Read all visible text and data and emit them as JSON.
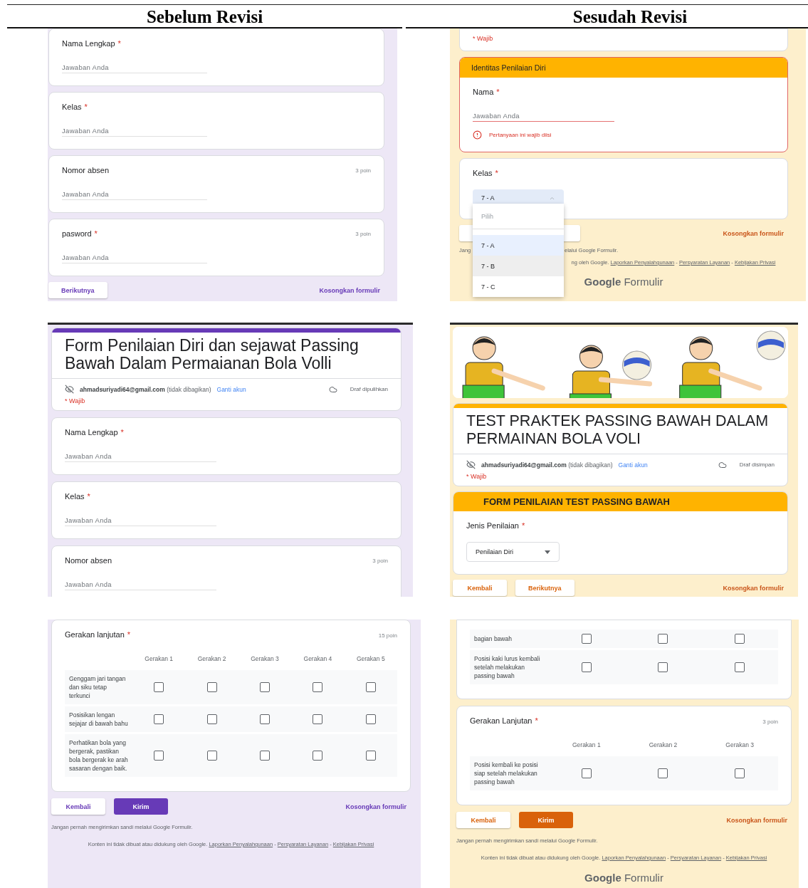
{
  "headings": [
    {
      "text": "Sebelum Revisi"
    },
    {
      "text": "Sesudah Revisi"
    }
  ],
  "panels": [
    {
      "kind": "purple",
      "blocks": [
        {
          "kind": "question",
          "label": "Nama Lengkap",
          "mark": "*",
          "placeholder": "Jawaban Anda"
        },
        {
          "kind": "question",
          "label": "Kelas",
          "mark": "*",
          "placeholder": "Jawaban Anda"
        },
        {
          "kind": "question",
          "label": "Nomor absen",
          "points": "3 poin",
          "placeholder": "Jawaban Anda"
        },
        {
          "kind": "question",
          "label": "pasword",
          "mark": "*",
          "points": "3 poin",
          "placeholder": "Jawaban Anda"
        },
        {
          "kind": "nav",
          "buttons": [
            {
              "label": "Berikutnya",
              "kind": "outlined"
            }
          ],
          "clear": "Kosongkan formulir"
        }
      ]
    },
    {
      "kind": "orange",
      "blocks": [
        {
          "kind": "note",
          "text": "* Wajib"
        },
        {
          "kind": "section",
          "title": "Identitas Penilaian Diri",
          "question": {
            "kind": "question",
            "label": "Nama",
            "mark": "*",
            "placeholder": "Jawaban Anda",
            "error": "Pertanyaan ini wajib diisi"
          }
        },
        {
          "kind": "select",
          "label": "Kelas",
          "mark": "*",
          "dropdown": {
            "value": "7 - A",
            "expanded": true,
            "options": [
              {
                "label": "Pilih",
                "kind": "placeholder",
                "selected": false,
                "highlighted": false
              },
              {
                "label": "7 - A",
                "kind": "option",
                "selected": true,
                "highlighted": false
              },
              {
                "label": "7 - B",
                "kind": "option",
                "selected": false,
                "highlighted": true
              },
              {
                "label": "7 - C",
                "kind": "option",
                "selected": false,
                "highlighted": false
              }
            ]
          }
        },
        {
          "kind": "nav",
          "buttons": [
            {
              "kind": "outlined"
            }
          ],
          "clear": "Kosongkan formulir"
        },
        {
          "kind": "covered_footer",
          "notice_parts": [
            "Jang",
            "elalui Google Formulir."
          ],
          "disclaimer": "ng oleh Google.",
          "links": [
            "Laporkan Penyalahgunaan",
            "Persyaratan Layanan",
            "Kebijakan Privasi"
          ],
          "separator": "-"
        },
        {
          "kind": "logo",
          "text": "**Google** Formulir"
        }
      ]
    },
    {
      "kind": "purple",
      "blocks": [
        {
          "kind": "header",
          "title": "Form Penilaian Diri dan sejawat Passing Bawah Dalam Permaianan Bola Volli",
          "account": "**ahmadsuriyadi64@gmail.com** (tidak dibagikan)",
          "switch": "Ganti akun",
          "draft": "Draf dipulihkan",
          "note": "* Wajib"
        },
        {
          "kind": "question",
          "label": "Nama Lengkap",
          "mark": "*",
          "placeholder": "Jawaban Anda"
        },
        {
          "kind": "question",
          "label": "Kelas",
          "mark": "*",
          "placeholder": "Jawaban Anda"
        },
        {
          "kind": "question",
          "label": "Nomor absen",
          "points": "3 poin",
          "placeholder": "Jawaban Anda"
        }
      ]
    },
    {
      "kind": "orange",
      "blocks": [
        {
          "kind": "banner"
        },
        {
          "kind": "header",
          "title": "TEST PRAKTEK PASSING BAWAH DALAM PERMAINAN BOLA VOLI",
          "account": "**ahmadsuriyadi64@gmail.com** (tidak dibagikan)",
          "switch": "Ganti akun",
          "draft": "Draf disimpan",
          "note": "* Wajib"
        },
        {
          "kind": "section",
          "title": "FORM PENILAIAN TEST PASSING BAWAH",
          "question": {
            "kind": "select",
            "label": "Jenis Penilaian",
            "mark": "*",
            "dropdown": {
              "value": "Penilaian Diri",
              "expanded": false
            }
          }
        },
        {
          "kind": "nav",
          "buttons": [
            {
              "label": "Kembali",
              "kind": "outlined"
            },
            {
              "label": "Berikutnya",
              "kind": "outlined"
            }
          ],
          "clear": "Kosongkan formulir"
        }
      ]
    },
    {
      "kind": "purple",
      "blocks": [
        {
          "kind": "grid",
          "label": "Gerakan lanjutan",
          "mark": "*",
          "points": "15 poin",
          "columns": [
            "Gerakan 1",
            "Gerakan 2",
            "Gerakan 3",
            "Gerakan 4",
            "Gerakan 5"
          ],
          "rows": [
            {
              "label": "Genggam jari tangan dan siku tetap terkunci",
              "checks": [
                {
                  "checked": false
                },
                {
                  "checked": false
                },
                {
                  "checked": false
                },
                {
                  "checked": false
                },
                {
                  "checked": false
                }
              ]
            },
            {
              "label": "Posisikan lengan sejajar di bawah bahu",
              "checks": [
                {
                  "checked": false
                },
                {
                  "checked": false
                },
                {
                  "checked": false
                },
                {
                  "checked": false
                },
                {
                  "checked": false
                }
              ]
            },
            {
              "label": "Perhatikan bola yang bergerak, pastikan bola bergerak ke arah sasaran dengan baik.",
              "checks": [
                {
                  "checked": false
                },
                {
                  "checked": false
                },
                {
                  "checked": false
                },
                {
                  "checked": false
                },
                {
                  "checked": false
                }
              ]
            }
          ]
        },
        {
          "kind": "nav",
          "buttons": [
            {
              "label": "Kembali",
              "kind": "outlined"
            },
            {
              "label": "Kirim",
              "kind": "filled"
            }
          ],
          "clear": "Kosongkan formulir"
        },
        {
          "kind": "footer",
          "notice": "Jangan pernah mengirimkan sandi melalui Google Formulir.",
          "disclaimer": "Konten ini tidak dibuat atau didukung oleh Google.",
          "links": [
            "Laporkan Penyalahgunaan",
            "Persyaratan Layanan",
            "Kebijakan Privasi"
          ],
          "separator": "-"
        }
      ]
    },
    {
      "kind": "orange",
      "blocks": [
        {
          "kind": "grid",
          "rows": [
            {
              "label": "bagian bawah",
              "checks": [
                {
                  "checked": false
                },
                {
                  "checked": false
                },
                {
                  "checked": false
                }
              ]
            },
            {
              "label": "Posisi kaki lurus kembali setelah melakukan passing bawah",
              "checks": [
                {
                  "checked": false
                },
                {
                  "checked": false
                },
                {
                  "checked": false
                }
              ]
            }
          ]
        },
        {
          "kind": "grid",
          "label": "Gerakan Lanjutan",
          "mark": "*",
          "points": "3 poin",
          "columns": [
            "Gerakan 1",
            "Gerakan 2",
            "Gerakan 3"
          ],
          "rows": [
            {
              "label": "Posisi kembali ke posisi siap setelah melakukan passing bawah",
              "checks": [
                {
                  "checked": false
                },
                {
                  "checked": false
                },
                {
                  "checked": false
                }
              ]
            }
          ]
        },
        {
          "kind": "nav",
          "buttons": [
            {
              "label": "Kembali",
              "kind": "outlined"
            },
            {
              "label": "Kirim",
              "kind": "filled"
            }
          ],
          "clear": "Kosongkan formulir"
        },
        {
          "kind": "footer",
          "notice": "Jangan pernah mengirimkan sandi melalui Google Formulir.",
          "disclaimer": "Konten ini tidak dibuat atau didukung oleh Google.",
          "links": [
            "Laporkan Penyalahgunaan",
            "Persyaratan Layanan",
            "Kebijakan Privasi"
          ],
          "separator": "-"
        },
        {
          "kind": "logo",
          "text": "**Google** Formulir"
        }
      ]
    }
  ]
}
